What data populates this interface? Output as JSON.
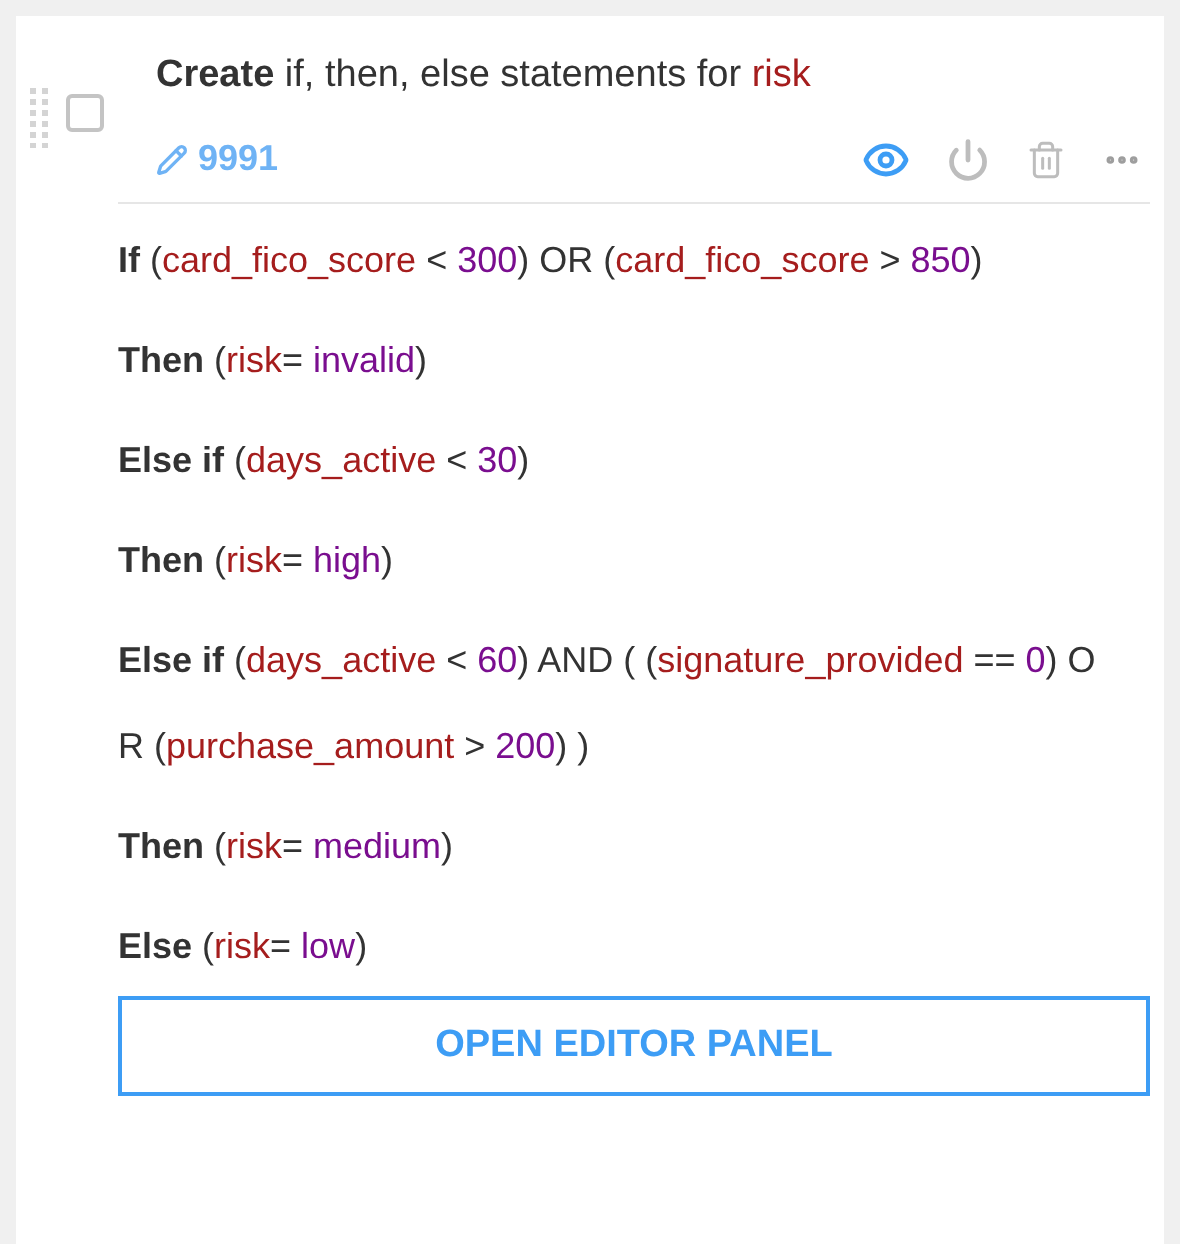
{
  "task": {
    "checked": false,
    "title": [
      {
        "kind": "bold",
        "text": "Create"
      },
      {
        "kind": "plain",
        "text": " if, then, else statements for "
      },
      {
        "kind": "variable",
        "text": "risk"
      }
    ],
    "id": "9991",
    "visible": true,
    "statements": [
      [
        {
          "kind": "keyword",
          "text": "If"
        },
        {
          "kind": "plain",
          "text": " ("
        },
        {
          "kind": "variable",
          "text": "card_fico_score"
        },
        {
          "kind": "plain",
          "text": " < "
        },
        {
          "kind": "value",
          "text": "300"
        },
        {
          "kind": "plain",
          "text": ") OR ("
        },
        {
          "kind": "variable",
          "text": "card_fico_score"
        },
        {
          "kind": "plain",
          "text": " > "
        },
        {
          "kind": "value",
          "text": "850"
        },
        {
          "kind": "plain",
          "text": ")"
        }
      ],
      [
        {
          "kind": "keyword",
          "text": "Then"
        },
        {
          "kind": "plain",
          "text": " ("
        },
        {
          "kind": "variable",
          "text": "risk"
        },
        {
          "kind": "plain",
          "text": "= "
        },
        {
          "kind": "value",
          "text": "invalid"
        },
        {
          "kind": "plain",
          "text": ")"
        }
      ],
      [
        {
          "kind": "keyword",
          "text": "Else if"
        },
        {
          "kind": "plain",
          "text": " ("
        },
        {
          "kind": "variable",
          "text": "days_active"
        },
        {
          "kind": "plain",
          "text": " < "
        },
        {
          "kind": "value",
          "text": "30"
        },
        {
          "kind": "plain",
          "text": ")"
        }
      ],
      [
        {
          "kind": "keyword",
          "text": "Then"
        },
        {
          "kind": "plain",
          "text": " ("
        },
        {
          "kind": "variable",
          "text": "risk"
        },
        {
          "kind": "plain",
          "text": "= "
        },
        {
          "kind": "value",
          "text": "high"
        },
        {
          "kind": "plain",
          "text": ")"
        }
      ],
      [
        {
          "kind": "keyword",
          "text": "Else if"
        },
        {
          "kind": "plain",
          "text": " ("
        },
        {
          "kind": "variable",
          "text": "days_active"
        },
        {
          "kind": "plain",
          "text": " < "
        },
        {
          "kind": "value",
          "text": "60"
        },
        {
          "kind": "plain",
          "text": ") AND ( ("
        },
        {
          "kind": "variable",
          "text": "signature_provided"
        },
        {
          "kind": "plain",
          "text": " == "
        },
        {
          "kind": "value",
          "text": "0"
        },
        {
          "kind": "plain",
          "text": ") OR ("
        },
        {
          "kind": "variable",
          "text": "purchase_amount"
        },
        {
          "kind": "plain",
          "text": " > "
        },
        {
          "kind": "value",
          "text": "200"
        },
        {
          "kind": "plain",
          "text": ") )"
        }
      ],
      [
        {
          "kind": "keyword",
          "text": "Then"
        },
        {
          "kind": "plain",
          "text": " ("
        },
        {
          "kind": "variable",
          "text": "risk"
        },
        {
          "kind": "plain",
          "text": "= "
        },
        {
          "kind": "value",
          "text": "medium"
        },
        {
          "kind": "plain",
          "text": ")"
        }
      ],
      [
        {
          "kind": "keyword",
          "text": "Else"
        },
        {
          "kind": "plain",
          "text": " ("
        },
        {
          "kind": "variable",
          "text": "risk"
        },
        {
          "kind": "plain",
          "text": "= "
        },
        {
          "kind": "value",
          "text": "low"
        },
        {
          "kind": "plain",
          "text": ")"
        }
      ]
    ],
    "button": "OPEN EDITOR PANEL"
  }
}
